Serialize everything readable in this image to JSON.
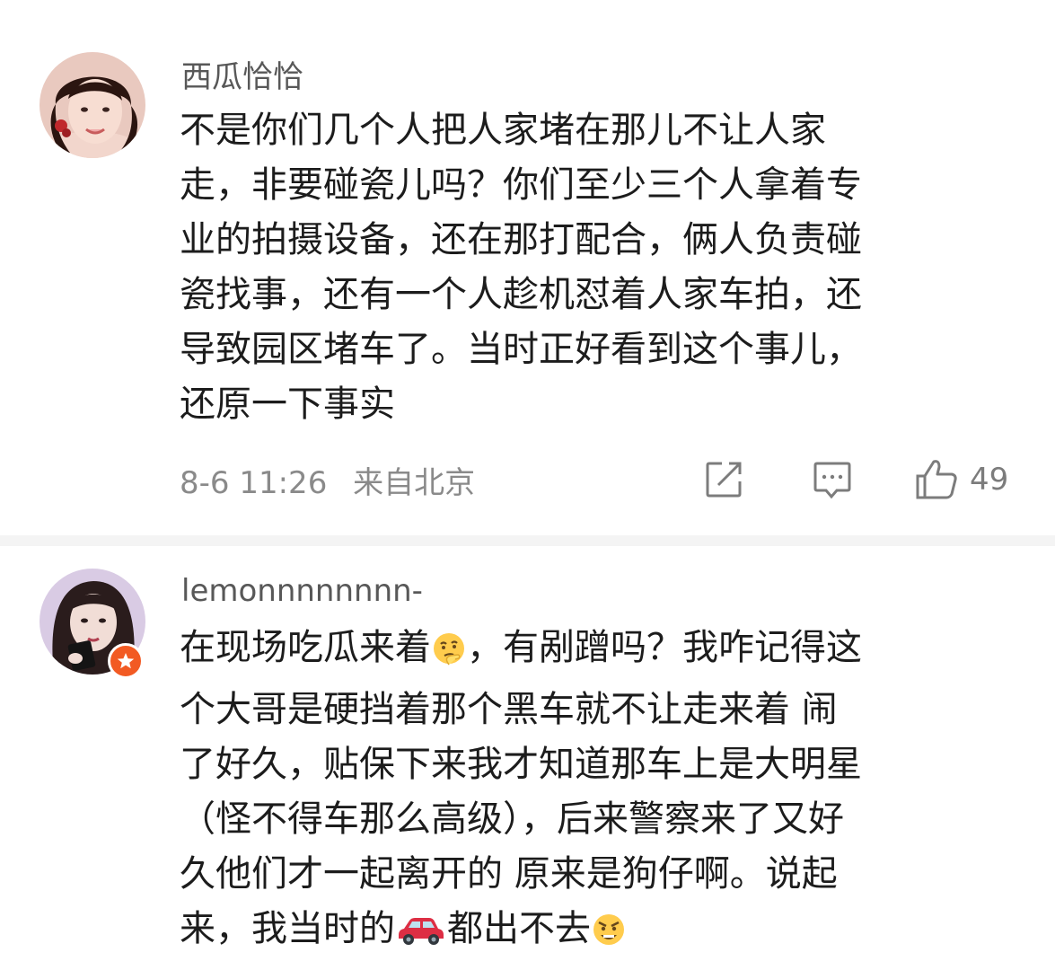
{
  "comments": [
    {
      "username": "西瓜恰恰",
      "lines": [
        "不是你们几个人把人家堵在那儿不让人家",
        "走，非要碰瓷儿吗？你们至少三个人拿着专",
        "业的拍摄设备，还在那打配合，俩人负责碰",
        "瓷找事，还有一个人趁机怼着人家车拍，还",
        "导致园区堵车了。当时正好看到这个事儿，",
        "还原一下事实"
      ],
      "date": "8-6 11:26",
      "location": "来自北京",
      "likes": "49",
      "icons": [
        "share-icon",
        "reply-icon",
        "like-icon"
      ]
    },
    {
      "username": "lemonnnnnnnn-",
      "lines": {
        "l1_before": "在现场吃瓜来着",
        "l1_after": "，有剐蹭吗？我咋记得这",
        "l2": "个大哥是硬挡着那个黑车就不让走来着  闹",
        "l3": "了好久，贴保下来我才知道那车上是大明星",
        "l4": "（怪不得车那么高级），后来警察来了又好",
        "l5": "久他们才一起离开的 原来是狗仔啊。说起",
        "l6_before": "来，我当时的",
        "l6_middle": "都出不去"
      },
      "emojis": [
        "thinking-face-emoji",
        "red-car-emoji",
        "angry-face-emoji"
      ],
      "badge": "verified-badge-icon"
    }
  ],
  "colors": {
    "text": "#1c1c1c",
    "secondary": "#8a8a8a",
    "username": "#585858",
    "badge": "#f25a23",
    "divider": "#f4f4f4"
  }
}
